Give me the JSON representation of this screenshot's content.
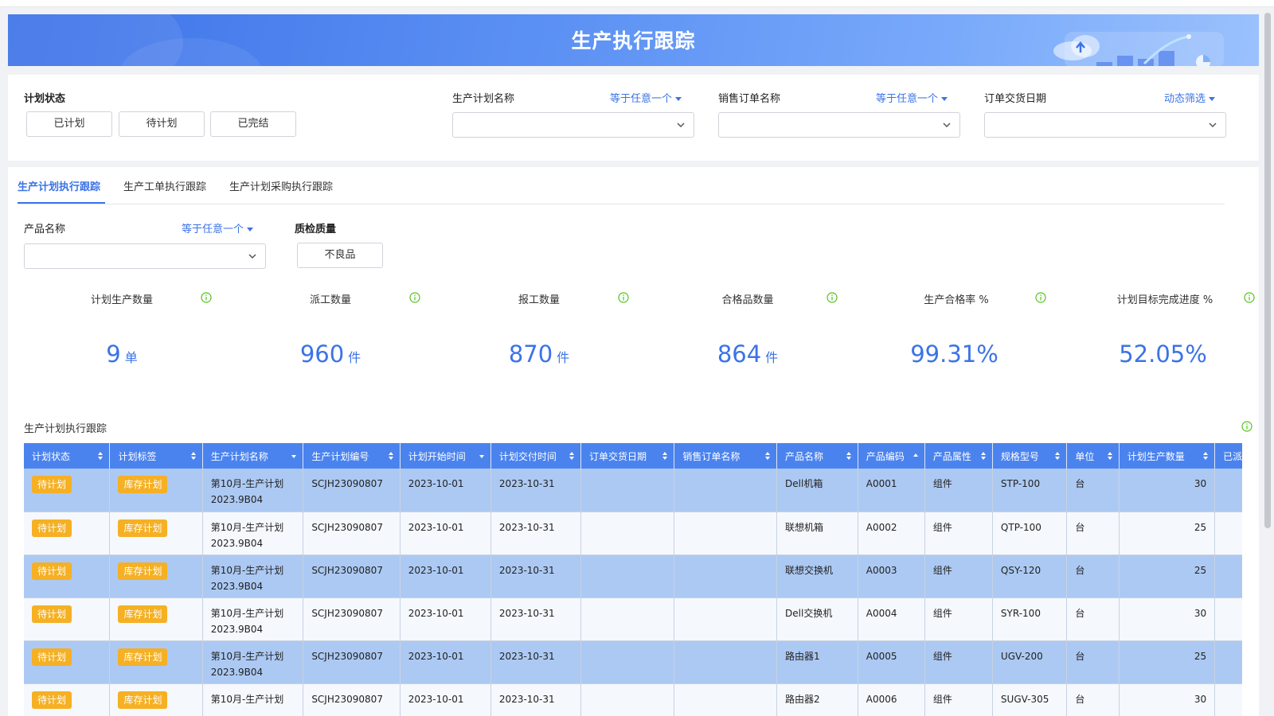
{
  "header": {
    "title": "生产执行跟踪"
  },
  "filters": {
    "plan_status": {
      "label": "计划状态",
      "options": [
        "已计划",
        "待计划",
        "已完结"
      ]
    },
    "plan_name": {
      "label": "生产计划名称",
      "operator": "等于任意一个"
    },
    "sales_order": {
      "label": "销售订单名称",
      "operator": "等于任意一个"
    },
    "delivery_date": {
      "label": "订单交货日期",
      "operator": "动态筛选"
    }
  },
  "tabs": [
    {
      "label": "生产计划执行跟踪"
    },
    {
      "label": "生产工单执行跟踪"
    },
    {
      "label": "生产计划采购执行跟踪"
    }
  ],
  "sub_filters": {
    "product_name": {
      "label": "产品名称",
      "operator": "等于任意一个"
    },
    "quality": {
      "label": "质检质量",
      "option": "不良品"
    }
  },
  "kpis": [
    {
      "title": "计划生产数量",
      "value": "9",
      "unit": "单"
    },
    {
      "title": "派工数量",
      "value": "960",
      "unit": "件"
    },
    {
      "title": "报工数量",
      "value": "870",
      "unit": "件"
    },
    {
      "title": "合格品数量",
      "value": "864",
      "unit": "件"
    },
    {
      "title": "生产合格率 %",
      "value": "99.31%",
      "unit": ""
    },
    {
      "title": "计划目标完成进度 %",
      "value": "52.05%",
      "unit": ""
    }
  ],
  "table": {
    "title": "生产计划执行跟踪",
    "columns": [
      "计划状态",
      "计划标签",
      "生产计划名称",
      "生产计划编号",
      "计划开始时间",
      "计划交付时间",
      "订单交货日期",
      "销售订单名称",
      "产品名称",
      "产品编码",
      "产品属性",
      "规格型号",
      "单位",
      "计划生产数量",
      "已派工数"
    ],
    "rows": [
      {
        "status": "待计划",
        "tag": "库存计划",
        "name_line1": "第10月-生产计划",
        "name_line2": "2023.9B04",
        "code": "SCJH23090807",
        "start": "2023-10-01",
        "deliver": "2023-10-31",
        "order_date": "",
        "order_name": "",
        "product": "Dell机箱",
        "product_code": "A0001",
        "attr": "组件",
        "spec": "STP-100",
        "unit": "台",
        "qty": "30",
        "dispatched": ""
      },
      {
        "status": "待计划",
        "tag": "库存计划",
        "name_line1": "第10月-生产计划",
        "name_line2": "2023.9B04",
        "code": "SCJH23090807",
        "start": "2023-10-01",
        "deliver": "2023-10-31",
        "order_date": "",
        "order_name": "",
        "product": "联想机箱",
        "product_code": "A0002",
        "attr": "组件",
        "spec": "QTP-100",
        "unit": "台",
        "qty": "25",
        "dispatched": ""
      },
      {
        "status": "待计划",
        "tag": "库存计划",
        "name_line1": "第10月-生产计划",
        "name_line2": "2023.9B04",
        "code": "SCJH23090807",
        "start": "2023-10-01",
        "deliver": "2023-10-31",
        "order_date": "",
        "order_name": "",
        "product": "联想交换机",
        "product_code": "A0003",
        "attr": "组件",
        "spec": "QSY-120",
        "unit": "台",
        "qty": "25",
        "dispatched": ""
      },
      {
        "status": "待计划",
        "tag": "库存计划",
        "name_line1": "第10月-生产计划",
        "name_line2": "2023.9B04",
        "code": "SCJH23090807",
        "start": "2023-10-01",
        "deliver": "2023-10-31",
        "order_date": "",
        "order_name": "",
        "product": "Dell交换机",
        "product_code": "A0004",
        "attr": "组件",
        "spec": "SYR-100",
        "unit": "台",
        "qty": "30",
        "dispatched": ""
      },
      {
        "status": "待计划",
        "tag": "库存计划",
        "name_line1": "第10月-生产计划",
        "name_line2": "2023.9B04",
        "code": "SCJH23090807",
        "start": "2023-10-01",
        "deliver": "2023-10-31",
        "order_date": "",
        "order_name": "",
        "product": "路由器1",
        "product_code": "A0005",
        "attr": "组件",
        "spec": "UGV-200",
        "unit": "台",
        "qty": "25",
        "dispatched": ""
      },
      {
        "status": "待计划",
        "tag": "库存计划",
        "name_line1": "第10月-生产计划",
        "name_line2": "",
        "code": "SCJH23090807",
        "start": "2023-10-01",
        "deliver": "2023-10-31",
        "order_date": "",
        "order_name": "",
        "product": "路由器2",
        "product_code": "A0006",
        "attr": "组件",
        "spec": "SUGV-305",
        "unit": "台",
        "qty": "30",
        "dispatched": ""
      }
    ]
  },
  "colors": {
    "primary": "#3b73e6",
    "header_bg": "#4b83ee",
    "row_highlight": "#acc9f3",
    "tag": "#f5b024",
    "info_icon": "#52c41a"
  }
}
